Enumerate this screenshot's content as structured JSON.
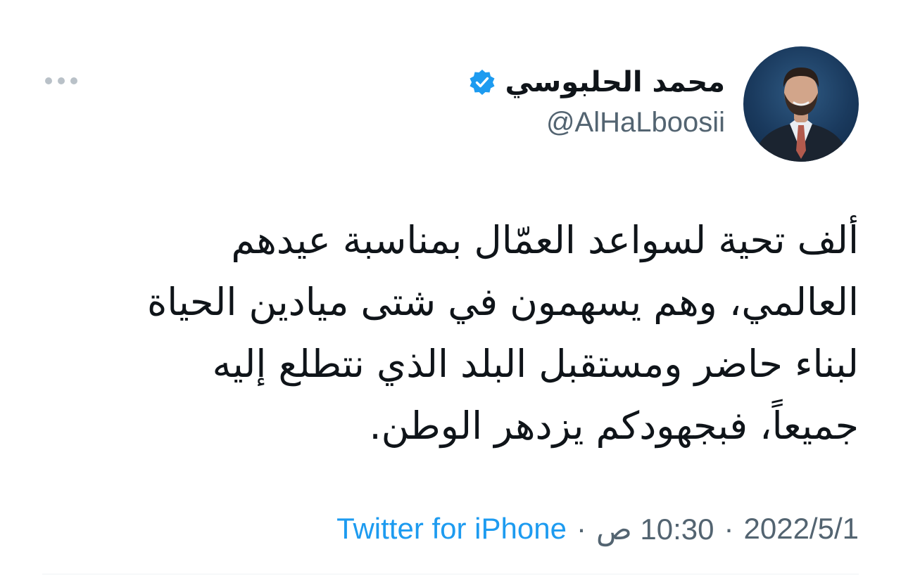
{
  "tweet": {
    "author": {
      "display_name": "محمد الحلبوسي",
      "handle": "@AlHaLboosii",
      "verified": true
    },
    "text_lines": [
      "ألف تحية لسواعد العمّال بمناسبة عيدهم",
      "العالمي، وهم يسهمون في شتى ميادين الحياة",
      "لبناء حاضر ومستقبل البلد الذي نتطلع إليه",
      "جميعاً، فبجهودكم يزدهر الوطن."
    ],
    "meta": {
      "date": "2022/5/1",
      "separator": "·",
      "time": "10:30 ص",
      "source": "Twitter for iPhone"
    }
  },
  "icons": {
    "verified": "verified-badge-icon",
    "more": "more-options-icon"
  },
  "colors": {
    "text": "#0f1419",
    "secondary": "#536471",
    "link": "#1d9bf0",
    "verified": "#1d9bf0",
    "divider": "#eff3f4"
  }
}
